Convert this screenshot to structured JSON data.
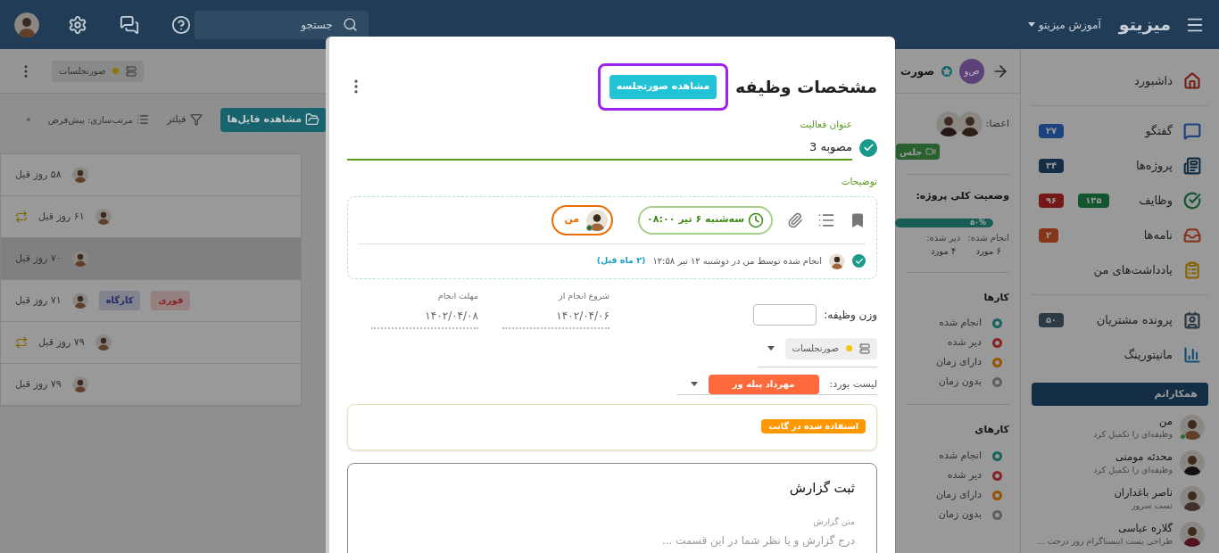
{
  "topbar": {
    "logo": "میزیتو",
    "workspace": "آموزش میزیتو",
    "search": {
      "placeholder": "جستجو"
    }
  },
  "sidebar": {
    "groups": [
      {
        "items": [
          {
            "label": "داشبورد",
            "color": "#73221a"
          }
        ]
      },
      {
        "items": [
          {
            "label": "گفتگو",
            "color": "#1c437d",
            "badges": [
              {
                "text": "۲۷",
                "color": "#1c437d"
              }
            ]
          },
          {
            "label": "پروژه‌ها",
            "color": "#132e45",
            "badges": [
              {
                "text": "۳۴",
                "color": "#132e45"
              }
            ]
          },
          {
            "label": "وظایف",
            "color": "#12552f",
            "badges": [
              {
                "text": "۱۳۵",
                "color": "#12552f"
              },
              {
                "text": "۹۶",
                "color": "#771818"
              }
            ]
          },
          {
            "label": "نامه‌ها",
            "color": "#86351a",
            "badges": [
              {
                "text": "۲",
                "color": "#86351a"
              }
            ]
          },
          {
            "label": "یادداشت‌های من",
            "color": "#866500"
          }
        ]
      },
      {
        "items": [
          {
            "label": "پرونده مشتریان",
            "color": "#2c3a44",
            "badges": [
              {
                "text": "۵۰",
                "color": "#2c3a44"
              }
            ]
          },
          {
            "label": "مانیتورینگ",
            "color": "#135078"
          }
        ]
      }
    ]
  },
  "colleagues": {
    "title": "همکارانم",
    "people": [
      {
        "name": "من",
        "status": "وظیفه‌ای را تکمیل کرد",
        "online": true
      },
      {
        "name": "محدثه مومنی",
        "status": "وظیفه‌ای را تکمیل کرد",
        "online": false
      },
      {
        "name": "ناصر باغداران",
        "status": "تست سرور",
        "online": false
      },
      {
        "name": "گلاره عباسی",
        "status": "طراحی پست اینستاگرام روز درخت ...",
        "online": false
      }
    ]
  },
  "project_panel": {
    "avatar_text": "ص‌و",
    "title": "صورت",
    "members_label": "اعضا:",
    "meeting_button": "جلس",
    "status_title": "وضعیت کلی پروژه:",
    "progress": {
      "level": 0.5,
      "label": "۵۰%"
    },
    "stats": [
      {
        "label": "انجام شده:",
        "value": "۶ مورد"
      },
      {
        "label": "دیر شده:",
        "value": "۴ مورد"
      }
    ],
    "sections": [
      {
        "title": "کارها",
        "legend": [
          {
            "label": "انجام شده",
            "color": "#17645c"
          },
          {
            "label": "دیر شده",
            "color": "#892222"
          },
          {
            "label": "دارای زمان",
            "color": "#975400"
          },
          {
            "label": "بدون زمان",
            "color": "#5f5f5f"
          }
        ]
      },
      {
        "title": "کارهای",
        "legend": [
          {
            "label": "انجام شده",
            "color": "#17645c"
          },
          {
            "label": "دیر شده",
            "color": "#892222"
          },
          {
            "label": "دارای زمان",
            "color": "#975400"
          },
          {
            "label": "بدون زمان",
            "color": "#5f5f5f"
          }
        ]
      }
    ]
  },
  "board": {
    "chip": "صورتجلسات",
    "files_button": "مشاهده فایل‌ها",
    "filter": "فیلتر",
    "sort": "مرتب‌سازی: پیش‌فرض",
    "rows": [
      {
        "time": "۵۸ روز قبل",
        "selected": false,
        "recurring": false
      },
      {
        "time": "۶۱ روز قبل",
        "selected": false,
        "recurring": true
      },
      {
        "time": "۷۰ روز قبل",
        "selected": true,
        "recurring": false
      },
      {
        "time": "۷۱ روز قبل",
        "selected": false,
        "recurring": false,
        "tags": [
          {
            "text": "فوری",
            "color": "#892222"
          },
          {
            "text": "کارگاه",
            "color": "#222c67"
          }
        ]
      },
      {
        "time": "۷۹ روز قبل",
        "selected": false,
        "recurring": true
      },
      {
        "time": "۷۹ روز قبل",
        "selected": false,
        "recurring": false
      }
    ]
  },
  "task_dialog": {
    "title": "مشخصات وظیفه",
    "meeting_button": "مشاهده صورتجلسه",
    "title_field": {
      "label": "عنوان فعالیت",
      "value": "مصوبه 3",
      "done": true
    },
    "description_label": "توضیحات",
    "due_chip": "سه‌شنبه ۶ تیر ۰۸:۰۰",
    "assignee": {
      "name": "من",
      "online": true
    },
    "completion": {
      "text": "انجام شده توسط  من در دوشنبه ۱۲ تیر ۱۲:۵۸",
      "ago": "(۲ ماه قبل)"
    },
    "weight": {
      "label": "وزن وظیفه:"
    },
    "start": {
      "label": "شروع انجام از",
      "value": "۱۴۰۲/۰۴/۰۶"
    },
    "deadline": {
      "label": "مهلت انجام",
      "value": "۱۴۰۲/۰۴/۰۸"
    },
    "project_select": "صورتجلسات",
    "board_list": {
      "label": "لیست بورد:",
      "value": "مهرداد پیله ور"
    },
    "gantt_badge": "استفاده شده در گانت",
    "report": {
      "title": "ثبت گزارش",
      "label": "متن گزارش",
      "placeholder": "درج گزارش و یا نظر شما در این قسمت ..."
    }
  }
}
